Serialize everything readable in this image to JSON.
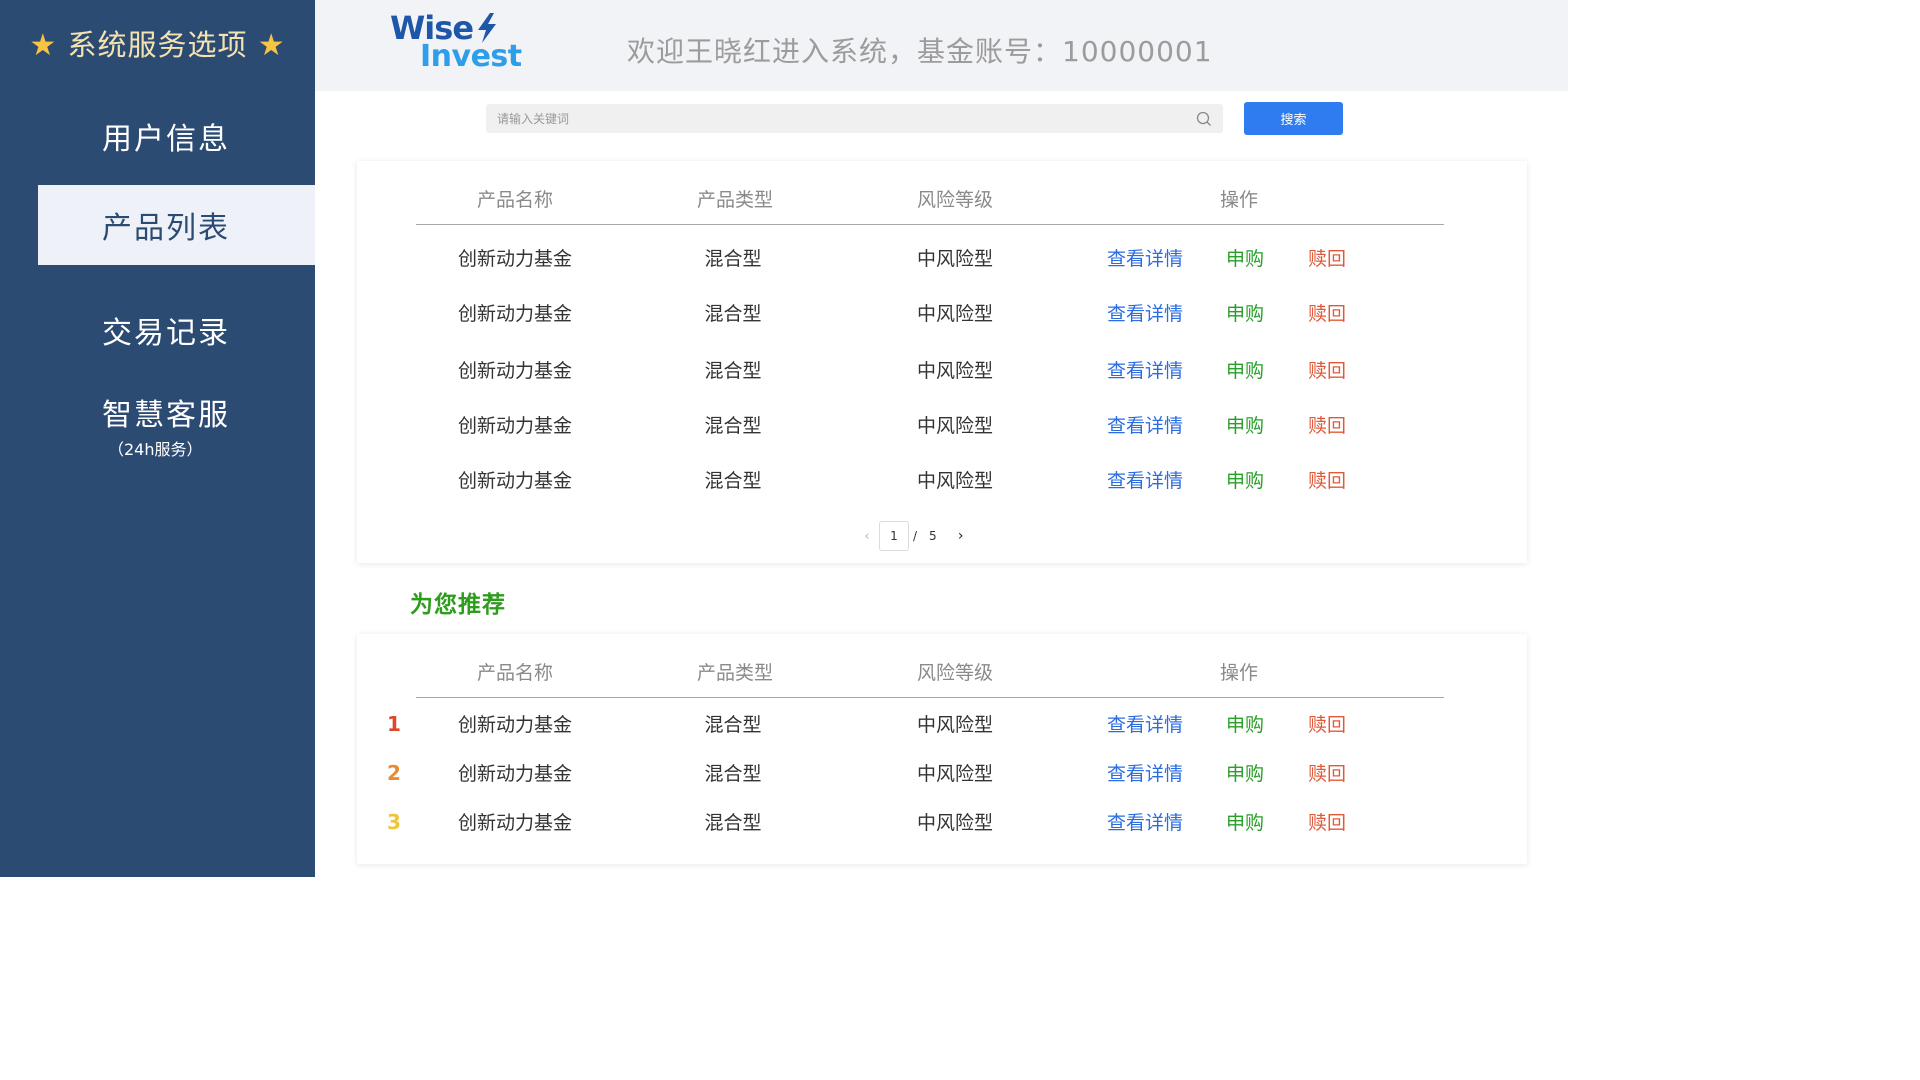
{
  "sidebar": {
    "title": "系统服务选项",
    "items": [
      {
        "label": "用户信息",
        "sub": ""
      },
      {
        "label": "产品列表",
        "sub": ""
      },
      {
        "label": "交易记录",
        "sub": ""
      },
      {
        "label": "智慧客服",
        "sub": "（24h服务）"
      }
    ],
    "active_index": 1
  },
  "header": {
    "logo_line1": "Wise",
    "logo_line2": "Invest",
    "welcome": "欢迎王晓红进入系统，基金账号：10000001"
  },
  "search": {
    "placeholder": "请输入关键词",
    "button_label": "搜索"
  },
  "table": {
    "headers": [
      "产品名称",
      "产品类型",
      "风险等级",
      "操作"
    ],
    "actions": {
      "detail": "查看详情",
      "buy": "申购",
      "redeem": "赎回"
    }
  },
  "products": [
    {
      "name": "创新动力基金",
      "type": "混合型",
      "risk": "中风险型"
    },
    {
      "name": "创新动力基金",
      "type": "混合型",
      "risk": "中风险型"
    },
    {
      "name": "创新动力基金",
      "type": "混合型",
      "risk": "中风险型"
    },
    {
      "name": "创新动力基金",
      "type": "混合型",
      "risk": "中风险型"
    },
    {
      "name": "创新动力基金",
      "type": "混合型",
      "risk": "中风险型"
    }
  ],
  "pagination": {
    "current": "1",
    "separator": "/",
    "total": "5",
    "prev": "‹",
    "next": "›"
  },
  "recommend": {
    "title": "为您推荐",
    "items": [
      {
        "rank": "1",
        "rank_color": "#e0462e",
        "name": "创新动力基金",
        "type": "混合型",
        "risk": "中风险型"
      },
      {
        "rank": "2",
        "rank_color": "#ec8a32",
        "name": "创新动力基金",
        "type": "混合型",
        "risk": "中风险型"
      },
      {
        "rank": "3",
        "rank_color": "#f0c53a",
        "name": "创新动力基金",
        "type": "混合型",
        "risk": "中风险型"
      }
    ]
  },
  "colors": {
    "sidebar_bg": "#2c4b73",
    "accent_blue": "#2f7cf0",
    "detail_blue": "#2b6de0",
    "buy_green": "#28a028",
    "redeem_red": "#e05a3a",
    "recommend_green": "#2e9d1e"
  }
}
